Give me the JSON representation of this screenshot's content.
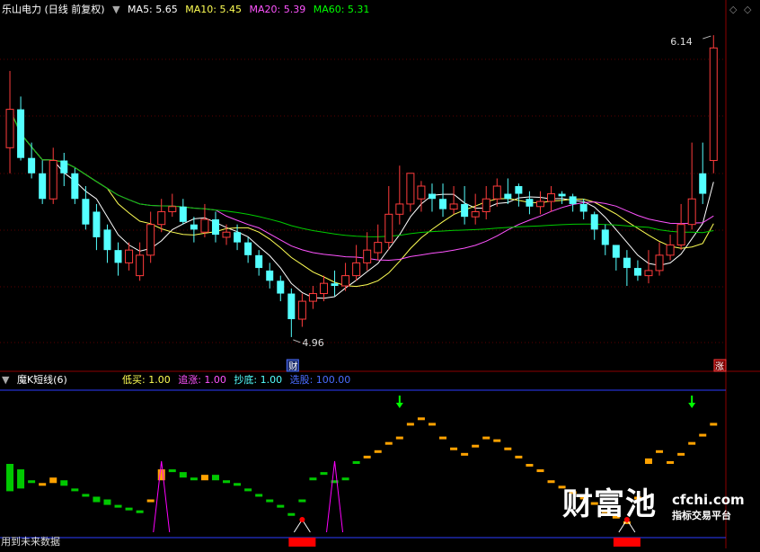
{
  "header": {
    "title": "乐山电力 (日线 前复权)",
    "ma5": "MA5: 5.65",
    "ma10": "MA10: 5.45",
    "ma20": "MA20: 5.39",
    "ma60": "MA60: 5.31"
  },
  "indicator": {
    "title": "魔K短线(6)",
    "buy_low": "低买: 1.00",
    "chase_up": "追涨: 1.00",
    "bottom_fish": "抄底: 1.00",
    "select_stock": "选股: 100.00"
  },
  "footer_note": "用到未来数据",
  "watermark": {
    "name": "财富池",
    "url": "cfchi.com",
    "slogan": "指标交易平台"
  },
  "markers": {
    "max_label": "6.14",
    "min_label": "4.96",
    "cai_badge": "财",
    "zhang_badge": "涨"
  },
  "colors": {
    "up": "#ff3c3c",
    "down": "#54ffff",
    "ma5": "#ffffff",
    "ma10": "#ffff54",
    "ma20": "#ff54ff",
    "ma60": "#00cc00",
    "ind_up": "#ffa200",
    "ind_down": "#00c800",
    "triangle": "#ff00ff",
    "signal_arrow": "#00ff00",
    "separator": "#8b0000",
    "bar_signal": "#ff0000"
  },
  "chart_data": [
    {
      "type": "candlestick",
      "x": [
        1,
        2,
        3,
        4,
        5,
        6,
        7,
        8,
        9,
        10,
        11,
        12,
        13,
        14,
        15,
        16,
        17,
        18,
        19,
        20,
        21,
        22,
        23,
        24,
        25,
        26,
        27,
        28,
        29,
        30,
        31,
        32,
        33,
        34,
        35,
        36,
        37,
        38,
        39,
        40,
        41,
        42,
        43,
        44,
        45,
        46,
        47,
        48,
        49,
        50,
        51,
        52,
        53,
        54,
        55,
        56,
        57,
        58,
        59,
        60,
        61,
        62,
        63,
        64,
        65,
        66
      ],
      "open": [
        5.7,
        5.85,
        5.66,
        5.6,
        5.5,
        5.65,
        5.6,
        5.5,
        5.45,
        5.38,
        5.3,
        5.25,
        5.2,
        5.28,
        5.4,
        5.45,
        5.47,
        5.4,
        5.37,
        5.42,
        5.35,
        5.37,
        5.33,
        5.28,
        5.22,
        5.18,
        5.13,
        5.03,
        5.1,
        5.13,
        5.17,
        5.16,
        5.2,
        5.25,
        5.29,
        5.33,
        5.44,
        5.48,
        5.5,
        5.52,
        5.5,
        5.46,
        5.48,
        5.43,
        5.45,
        5.5,
        5.52,
        5.55,
        5.5,
        5.47,
        5.49,
        5.52,
        5.51,
        5.48,
        5.44,
        5.38,
        5.32,
        5.27,
        5.23,
        5.2,
        5.22,
        5.28,
        5.32,
        5.4,
        5.6,
        5.65
      ],
      "close": [
        5.85,
        5.66,
        5.6,
        5.5,
        5.65,
        5.6,
        5.5,
        5.4,
        5.35,
        5.3,
        5.25,
        5.3,
        5.28,
        5.4,
        5.45,
        5.47,
        5.41,
        5.38,
        5.42,
        5.36,
        5.37,
        5.33,
        5.28,
        5.23,
        5.18,
        5.13,
        5.03,
        5.1,
        5.13,
        5.17,
        5.16,
        5.2,
        5.25,
        5.3,
        5.33,
        5.44,
        5.48,
        5.6,
        5.55,
        5.5,
        5.46,
        5.48,
        5.43,
        5.45,
        5.5,
        5.55,
        5.5,
        5.52,
        5.47,
        5.49,
        5.52,
        5.51,
        5.48,
        5.45,
        5.38,
        5.32,
        5.27,
        5.23,
        5.2,
        5.22,
        5.28,
        5.32,
        5.4,
        5.5,
        5.52,
        6.09
      ],
      "high": [
        6.0,
        5.9,
        5.72,
        5.65,
        5.7,
        5.68,
        5.62,
        5.55,
        5.48,
        5.4,
        5.33,
        5.33,
        5.33,
        5.45,
        5.5,
        5.52,
        5.5,
        5.43,
        5.48,
        5.45,
        5.4,
        5.4,
        5.35,
        5.3,
        5.25,
        5.2,
        5.15,
        5.13,
        5.16,
        5.2,
        5.22,
        5.25,
        5.32,
        5.37,
        5.4,
        5.55,
        5.63,
        5.6,
        5.57,
        5.56,
        5.56,
        5.55,
        5.55,
        5.52,
        5.55,
        5.58,
        5.58,
        5.56,
        5.53,
        5.53,
        5.55,
        5.53,
        5.52,
        5.5,
        5.45,
        5.4,
        5.32,
        5.3,
        5.26,
        5.3,
        5.33,
        5.36,
        5.48,
        5.72,
        5.72,
        6.14
      ],
      "low": [
        5.6,
        5.65,
        5.58,
        5.48,
        5.48,
        5.55,
        5.48,
        5.38,
        5.3,
        5.25,
        5.2,
        5.22,
        5.18,
        5.25,
        5.37,
        5.43,
        5.4,
        5.33,
        5.35,
        5.33,
        5.32,
        5.3,
        5.25,
        5.2,
        5.15,
        5.1,
        4.96,
        5.0,
        5.07,
        5.1,
        5.12,
        5.14,
        5.18,
        5.22,
        5.26,
        5.3,
        5.4,
        5.45,
        5.45,
        5.45,
        5.43,
        5.44,
        5.4,
        5.4,
        5.42,
        5.47,
        5.48,
        5.47,
        5.44,
        5.44,
        5.45,
        5.48,
        5.45,
        5.42,
        5.34,
        5.28,
        5.22,
        5.16,
        5.18,
        5.17,
        5.2,
        5.26,
        5.3,
        5.38,
        5.48,
        5.6
      ],
      "ylim": [
        4.9,
        6.2
      ]
    },
    {
      "type": "bar",
      "name": "魔K短线",
      "x": [
        1,
        2,
        3,
        4,
        5,
        6,
        7,
        8,
        9,
        10,
        11,
        12,
        13,
        14,
        15,
        16,
        17,
        18,
        19,
        20,
        21,
        22,
        23,
        24,
        25,
        26,
        27,
        28,
        29,
        30,
        31,
        32,
        33,
        34,
        35,
        36,
        37,
        38,
        39,
        40,
        41,
        42,
        43,
        44,
        45,
        46,
        47,
        48,
        49,
        50,
        51,
        52,
        53,
        54,
        55,
        56,
        57,
        58,
        59,
        60,
        61,
        62,
        63,
        64,
        65,
        66
      ],
      "open": [
        50,
        46,
        38,
        34,
        36,
        38,
        32,
        28,
        26,
        24,
        20,
        18,
        16,
        22,
        38,
        46,
        44,
        40,
        38,
        42,
        38,
        36,
        32,
        28,
        24,
        20,
        14,
        24,
        40,
        44,
        38,
        40,
        52,
        56,
        60,
        66,
        70,
        80,
        84,
        80,
        70,
        62,
        58,
        64,
        70,
        68,
        62,
        56,
        50,
        46,
        38,
        34,
        30,
        26,
        22,
        16,
        12,
        8,
        26,
        50,
        60,
        52,
        58,
        66,
        72,
        78
      ],
      "close": [
        30,
        32,
        36,
        36,
        40,
        34,
        30,
        26,
        22,
        20,
        18,
        16,
        14,
        24,
        46,
        44,
        40,
        38,
        42,
        38,
        36,
        34,
        30,
        26,
        22,
        18,
        12,
        22,
        38,
        42,
        36,
        38,
        50,
        56,
        60,
        66,
        70,
        80,
        84,
        80,
        70,
        62,
        58,
        64,
        70,
        68,
        62,
        56,
        50,
        46,
        38,
        34,
        30,
        26,
        22,
        16,
        12,
        8,
        26,
        54,
        60,
        52,
        58,
        66,
        72,
        80
      ],
      "signals_buy_low": [
        28,
        58
      ],
      "signals_chase_up": [
        37,
        64
      ],
      "signals_bottom_fish": [
        15,
        31
      ],
      "ylim": [
        0,
        100
      ]
    }
  ]
}
